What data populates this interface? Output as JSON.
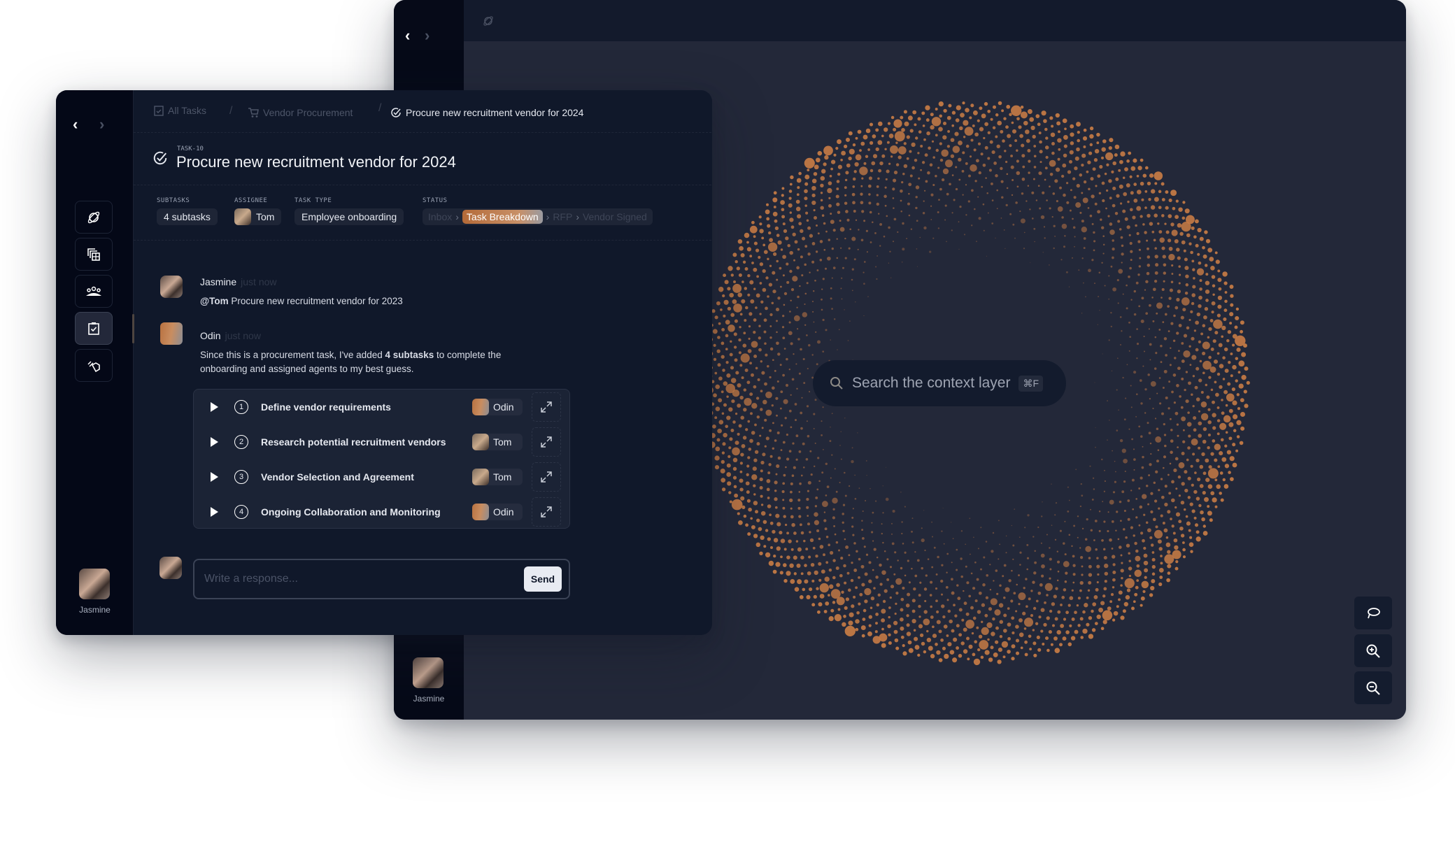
{
  "back_window": {
    "user": {
      "name": "Jasmine"
    },
    "search": {
      "placeholder": "Search the context layer",
      "shortcut": "⌘F"
    },
    "graph": {
      "dot_color": "#c47a45",
      "background": "#232839"
    },
    "controls": [
      "lasso-icon",
      "zoom-in-icon",
      "zoom-out-icon"
    ]
  },
  "front_window": {
    "breadcrumb": [
      {
        "label": "All Tasks",
        "icon": "clipboard-icon"
      },
      {
        "label": "Vendor Procurement",
        "icon": "cart-icon"
      },
      {
        "label": "Procure new recruitment vendor for 2024",
        "icon": "check-circle-icon"
      }
    ],
    "sidebar": {
      "items": [
        "planet-icon",
        "documents-icon",
        "team-icon",
        "tasks-icon",
        "layers-icon"
      ],
      "active": 3,
      "user": "Jasmine"
    },
    "task": {
      "id": "TASK-10",
      "title": "Procure new recruitment vendor for 2024"
    },
    "meta": {
      "subtasks_label": "SUBTASKS",
      "subtasks": "4 subtasks",
      "assignee_label": "ASSIGNEE",
      "assignee": "Tom",
      "type_label": "TASK TYPE",
      "type": "Employee onboarding",
      "status_label": "STATUS",
      "status_steps": [
        "Inbox",
        "Task Breakdown",
        "RFP",
        "Vendor Signed"
      ],
      "status_current": "Task Breakdown",
      "accent": "#b8703f"
    },
    "messages": [
      {
        "author": "Jasmine",
        "time": "just now",
        "mention": "@Tom",
        "text": " Procure new recruitment vendor for 2023"
      },
      {
        "author": "Odin",
        "time": "just now",
        "text_before": "Since this is a procurement task, I've added ",
        "bold": "4 subtasks",
        "text_after": " to complete the onboarding and assigned agents to my best guess."
      }
    ],
    "subtasks": [
      {
        "n": "1",
        "title": "Define vendor requirements",
        "assignee": "Odin"
      },
      {
        "n": "2",
        "title": "Research potential recruitment vendors",
        "assignee": "Tom"
      },
      {
        "n": "3",
        "title": "Vendor Selection and Agreement",
        "assignee": "Tom"
      },
      {
        "n": "4",
        "title": "Ongoing Collaboration and Monitoring",
        "assignee": "Odin"
      }
    ],
    "reply": {
      "placeholder": "Write a response...",
      "send": "Send"
    }
  }
}
